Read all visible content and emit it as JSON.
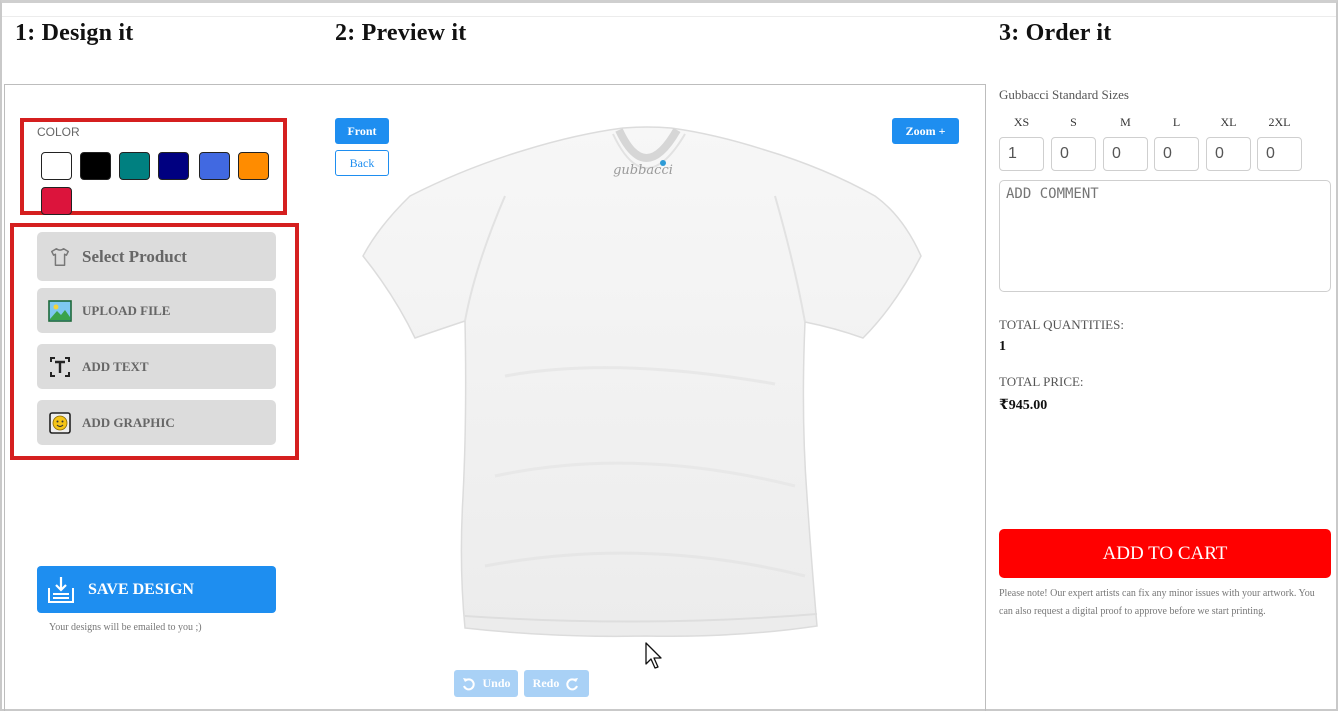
{
  "steps": {
    "design": "1: Design it",
    "preview": "2: Preview it",
    "order": "3: Order it"
  },
  "color_picker": {
    "label": "COLOR",
    "swatches": [
      "#ffffff",
      "#000000",
      "#008080",
      "#000080",
      "#4169e1",
      "#ff8c00",
      "#dc143c"
    ]
  },
  "tools": {
    "select_product": "Select Product",
    "upload_file": "UPLOAD FILE",
    "add_text": "ADD TEXT",
    "add_graphic": "ADD GRAPHIC",
    "icons": [
      "tshirt-icon",
      "image-icon",
      "text-icon",
      "emoji-icon"
    ]
  },
  "save": {
    "label": "SAVE DESIGN",
    "note": "Your designs will be emailed to you ;)"
  },
  "preview": {
    "front": "Front",
    "back": "Back",
    "zoom": "Zoom +",
    "brand": "gubbacci",
    "undo": "Undo",
    "redo": "Redo"
  },
  "order": {
    "sizes_title": "Gubbacci Standard Sizes",
    "sizes": [
      "XS",
      "S",
      "M",
      "L",
      "XL",
      "2XL"
    ],
    "quantities": [
      "1",
      "0",
      "0",
      "0",
      "0",
      "0"
    ],
    "comment_placeholder": "ADD COMMENT",
    "total_qty_label": "TOTAL QUANTITIES:",
    "total_qty": "1",
    "total_price_label": "TOTAL PRICE:",
    "total_price": "₹945.00",
    "cart_label": "ADD TO CART",
    "note": "Please note! Our expert artists can fix any minor issues with your artwork. You can also request a digital proof to approve before we start printing."
  },
  "colors": {
    "accent_blue": "#1e8ef0",
    "cart_red": "#ff0000",
    "highlight_red": "#d51f1f"
  }
}
